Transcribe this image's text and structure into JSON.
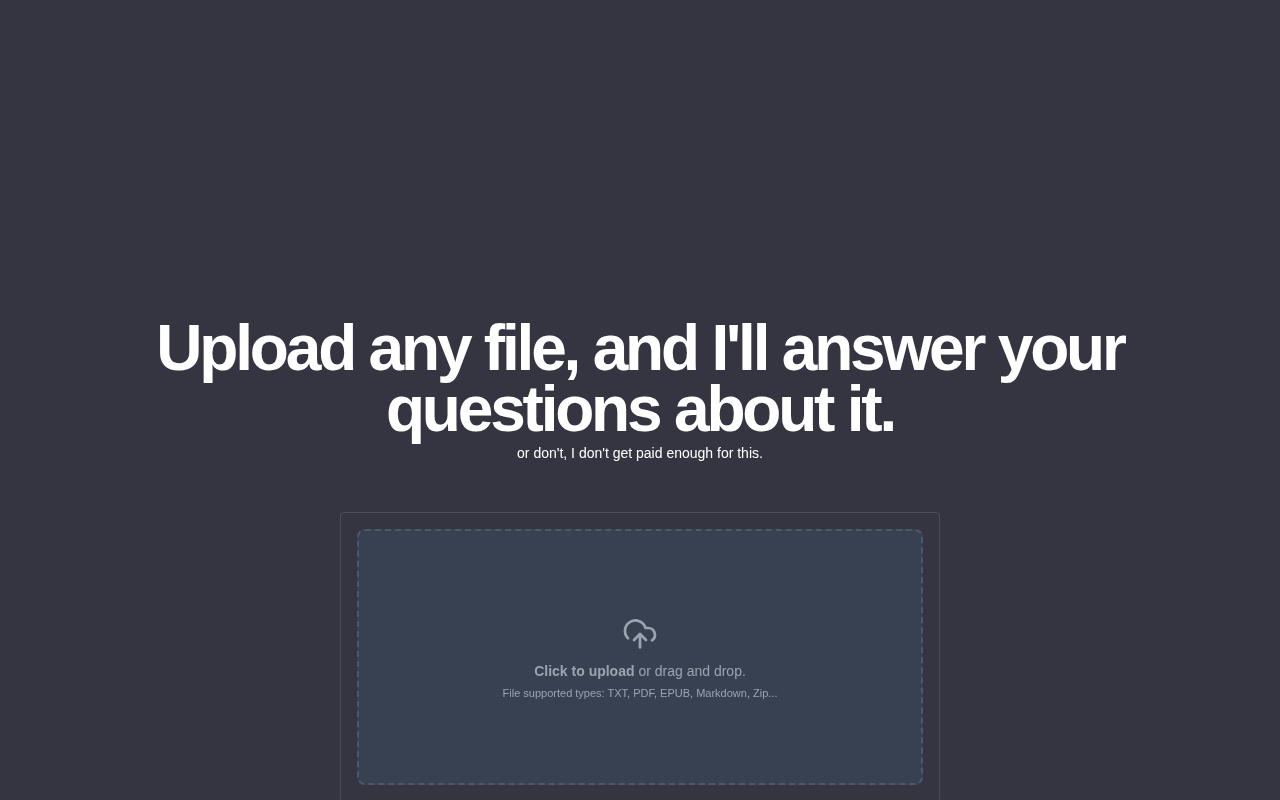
{
  "heading": "Upload any file, and I'll answer your questions about it.",
  "subheading": "or don't, I don't get paid enough for this.",
  "dropzone": {
    "prompt": "**Click to upload** or drag and drop.",
    "types": "File supported types: TXT, PDF, EPUB, Markdown, Zip..."
  }
}
